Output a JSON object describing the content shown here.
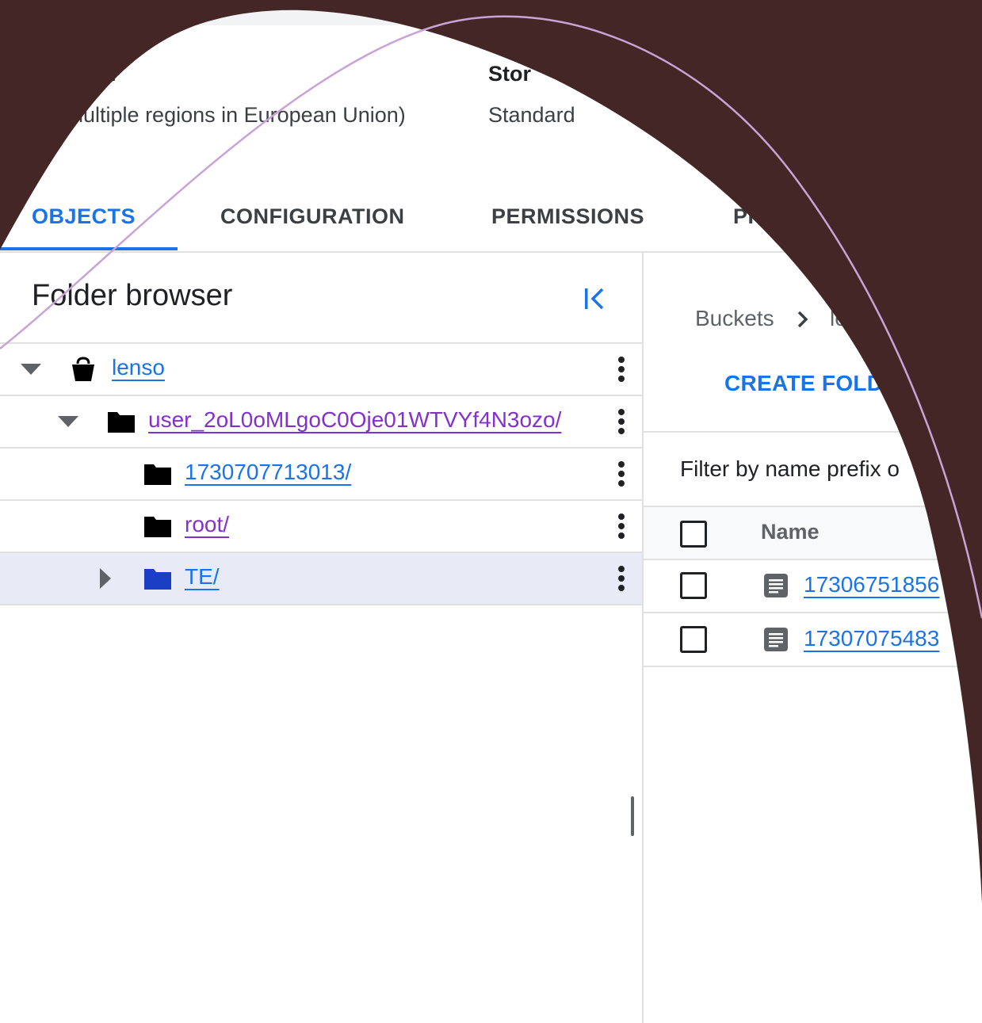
{
  "header": {
    "location_value": "hultiple regions in European Union)",
    "storage_class_label": "Stor",
    "storage_class_value": "Standard",
    "location_label_fragment": "n"
  },
  "tabs": [
    {
      "label": "OBJECTS",
      "active": true
    },
    {
      "label": "CONFIGURATION",
      "active": false
    },
    {
      "label": "PERMISSIONS",
      "active": false
    },
    {
      "label": "PR",
      "active": false
    }
  ],
  "folder_browser": {
    "title": "Folder browser",
    "collapse_icon": "collapse-left-icon",
    "tree": [
      {
        "label": "lenso",
        "icon": "bucket-icon",
        "expanded": true,
        "level": 0
      },
      {
        "label": "user_2oL0oMLgoC0Oje01WTVYf4N3ozo/",
        "icon": "folder-icon",
        "expanded": true,
        "level": 1,
        "visited": true
      },
      {
        "label": "1730707713013/",
        "icon": "folder-icon",
        "level": 2
      },
      {
        "label": "root/",
        "icon": "folder-icon",
        "level": 2,
        "visited": true
      },
      {
        "label": "TE/",
        "icon": "folder-icon",
        "level": 2,
        "collapsed": true,
        "selected": true
      }
    ]
  },
  "objects_pane": {
    "breadcrumb": [
      "Buckets",
      "le"
    ],
    "create_folder_label": "CREATE FOLDE",
    "filter_placeholder": "Filter by name prefix o",
    "columns": [
      "Name"
    ],
    "rows": [
      {
        "name": "17306751856"
      },
      {
        "name": "17307075483"
      }
    ]
  },
  "colors": {
    "accent": "#1a73e8",
    "visited_link": "#8430ce",
    "overlay": "#442626",
    "overlay_line": "#c9a3d6"
  }
}
